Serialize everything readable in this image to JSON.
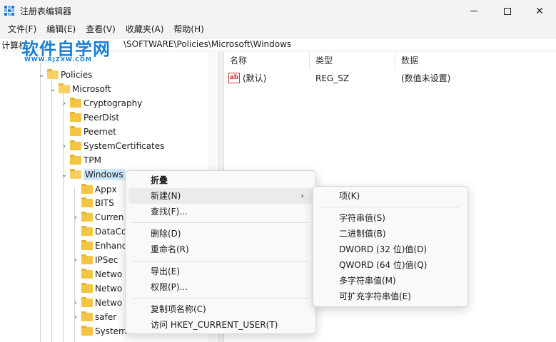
{
  "window": {
    "title": "注册表编辑器",
    "min_glyph": "",
    "close_glyph": "✕"
  },
  "menubar": [
    "文件(F)",
    "编辑(E)",
    "查看(V)",
    "收藏夹(A)",
    "帮助(H)"
  ],
  "address": {
    "prefix": "计算机",
    "path": "\\SOFTWARE\\Policies\\Microsoft\\Windows"
  },
  "watermark": {
    "title": "软件自学网",
    "url": "WWW.RJZXW.COM"
  },
  "tree": {
    "policies": "Policies",
    "microsoft": "Microsoft",
    "cryptography": "Cryptography",
    "peerdist": "PeerDist",
    "peernet": "Peernet",
    "systemcertificates": "SystemCertificates",
    "tpm": "TPM",
    "windows": "Windows",
    "appx": "Appx",
    "bits": "BITS",
    "curren": "Curren",
    "dataco": "DataCo",
    "enhanc": "Enhanc",
    "ipsec": "IPSec",
    "netwo1": "Netwo",
    "netwo2": "Netwo",
    "netwo3": "Netwo",
    "safer": "safer",
    "system": "System"
  },
  "list": {
    "headers": {
      "name": "名称",
      "type": "类型",
      "data": "数据"
    },
    "rows": [
      {
        "name": "(默认)",
        "type": "REG_SZ",
        "data": "(数值未设置)",
        "icon": "ab"
      }
    ]
  },
  "context_menu": {
    "collapse": "折叠",
    "new": "新建(N)",
    "find": "查找(F)...",
    "delete": "删除(D)",
    "rename": "重命名(R)",
    "export": "导出(E)",
    "permissions": "权限(P)...",
    "copy_key_name": "复制项名称(C)",
    "goto_hkcu": "访问 HKEY_CURRENT_USER(T)",
    "submenu_arrow": "›"
  },
  "submenu": {
    "key": "项(K)",
    "string": "字符串值(S)",
    "binary": "二进制值(B)",
    "dword": "DWORD (32 位)值(D)",
    "qword": "QWORD (64 位)值(Q)",
    "multi_string": "多字符串值(M)",
    "expandable_string": "可扩充字符串值(E)"
  },
  "colors": {
    "accent": "#1e7ad6",
    "folder": "#f4c542",
    "selection": "#cce8ff",
    "watermark": "#1a7fd4"
  }
}
